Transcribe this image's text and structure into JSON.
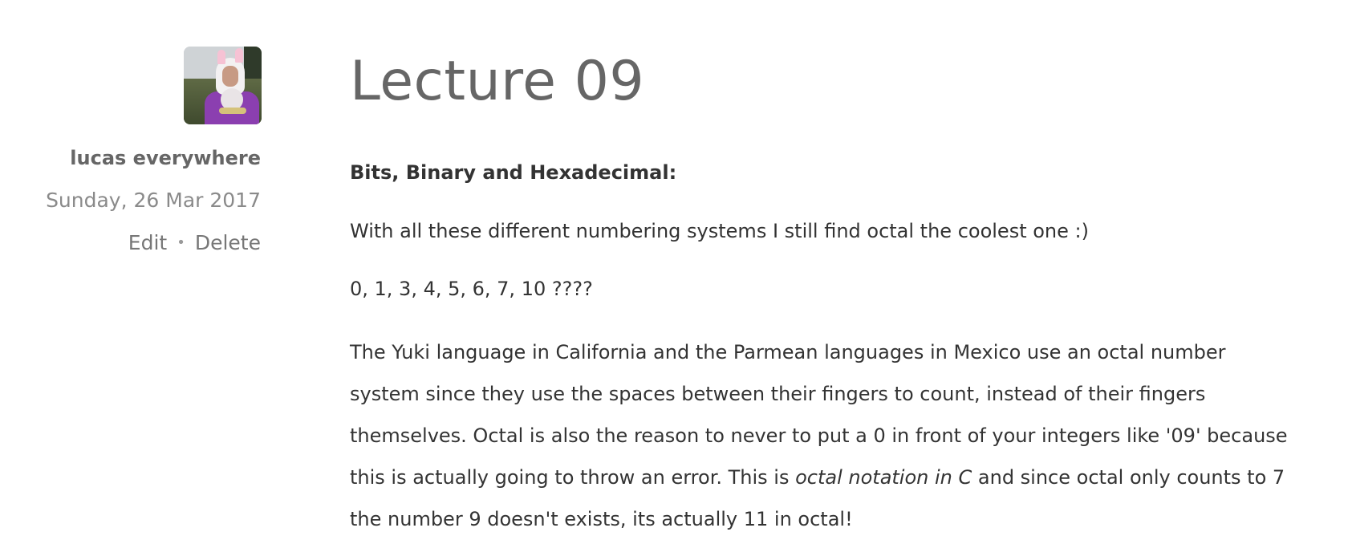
{
  "post": {
    "title": "Lecture 09",
    "author": {
      "name": "lucas everywhere",
      "date": "Sunday, 26 Mar 2017",
      "avatar": "author-avatar-photo"
    },
    "actions": {
      "edit_label": "Edit",
      "separator": "•",
      "delete_label": "Delete"
    },
    "content": {
      "heading": "Bits, Binary and Hexadecimal:",
      "paragraph1": "With all these different numbering systems I still find octal the coolest one :)",
      "paragraph2": "0, 1, 3, 4, 5, 6, 7, 10 ????",
      "paragraph3_lines": [
        "The Yuki language in California and the Parmean languages in Mexico use an octal number",
        "system since they use the spaces between their fingers to count, instead of their fingers",
        "themselves. Octal is also the reason to never to put a 0 in front of your integers like '09' because"
      ],
      "paragraph3_line4_before": "this is actually going to throw an error. This is ",
      "paragraph3_line4_em": "octal notation in C",
      "paragraph3_line4_after": " and since octal only counts to 7",
      "paragraph3_line5": "the number 9 doesn't exists, its actually 11 in octal!"
    }
  }
}
